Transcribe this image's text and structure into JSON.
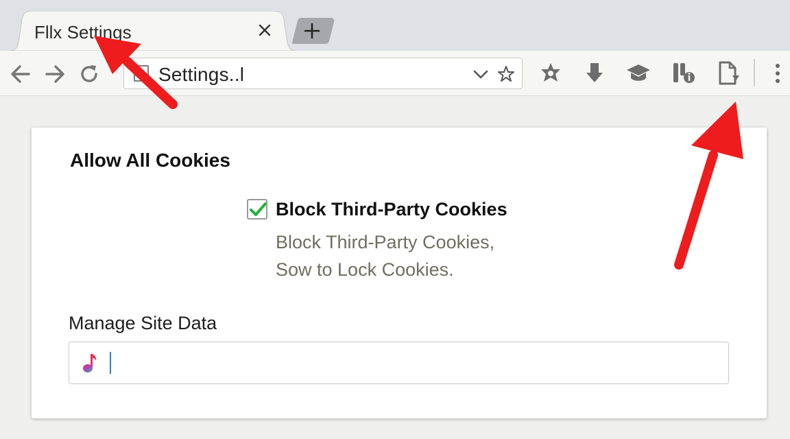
{
  "tab": {
    "title": "Fllx Settings",
    "close_icon": "close-icon",
    "new_tab_icon": "plus-icon"
  },
  "toolbar": {
    "back_icon": "back-arrow-icon",
    "forward_icon": "forward-arrow-icon",
    "reload_icon": "reload-icon",
    "address_text": "Settings..l",
    "icons": [
      "star-badge-icon",
      "download-icon",
      "graduation-cap-icon",
      "extension-info-icon",
      "document-download-icon",
      "more-vertical-icon"
    ]
  },
  "settings": {
    "heading": "Allow All Cookies",
    "block_third_party": {
      "checked": true,
      "label": "Block Third-Party Cookies",
      "description_line1": "Block Third-Party Cookies,",
      "description_line2": "Sow to Lock Cookies."
    },
    "manage_site_data": {
      "label": "Manage Site Data",
      "input_value": ""
    }
  },
  "colors": {
    "annotation_arrow": "#ee1c1c",
    "checkmark": "#1db33a",
    "description_text": "#6f6e5f",
    "caret": "#2a7fd4"
  }
}
